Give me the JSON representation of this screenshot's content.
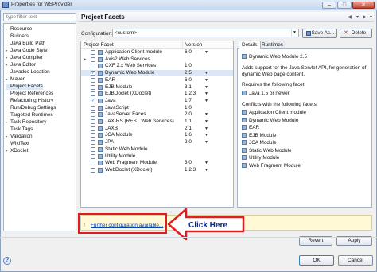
{
  "window": {
    "title": "Properties for WSProvider",
    "controls": [
      "–",
      "□",
      "✕"
    ]
  },
  "sidebar": {
    "filter_placeholder": "type filter text",
    "items": [
      {
        "label": "Resource",
        "expandable": true
      },
      {
        "label": "Builders",
        "expandable": false
      },
      {
        "label": "Java Build Path",
        "expandable": false
      },
      {
        "label": "Java Code Style",
        "expandable": true
      },
      {
        "label": "Java Compiler",
        "expandable": true
      },
      {
        "label": "Java Editor",
        "expandable": true
      },
      {
        "label": "Javadoc Location",
        "expandable": false
      },
      {
        "label": "Maven",
        "expandable": true
      },
      {
        "label": "Project Facets",
        "expandable": false,
        "selected": true
      },
      {
        "label": "Project References",
        "expandable": false
      },
      {
        "label": "Refactoring History",
        "expandable": false
      },
      {
        "label": "Run/Debug Settings",
        "expandable": false
      },
      {
        "label": "Targeted Runtimes",
        "expandable": false
      },
      {
        "label": "Task Repository",
        "expandable": true
      },
      {
        "label": "Task Tags",
        "expandable": false
      },
      {
        "label": "Validation",
        "expandable": true
      },
      {
        "label": "WikiText",
        "expandable": false
      },
      {
        "label": "XDoclet",
        "expandable": true
      }
    ]
  },
  "main": {
    "title": "Project Facets",
    "configuration_label": "Configuration:",
    "configuration_value": "<custom>",
    "save_as_label": "Save As...",
    "delete_label": "Delete",
    "table": {
      "col_facet": "Project Facet",
      "col_version": "Version",
      "rows": [
        {
          "name": "Application Client module",
          "version": "6.0",
          "checked": false,
          "dropdown": true
        },
        {
          "name": "Axis2 Web Services",
          "version": "",
          "checked": false,
          "expandable": true
        },
        {
          "name": "CXF 2.x Web Services",
          "version": "1.0",
          "checked": false
        },
        {
          "name": "Dynamic Web Module",
          "version": "2.5",
          "checked": true,
          "highlight": true,
          "dropdown": true
        },
        {
          "name": "EAR",
          "version": "6.0",
          "checked": false,
          "dropdown": true
        },
        {
          "name": "EJB Module",
          "version": "3.1",
          "checked": false,
          "dropdown": true
        },
        {
          "name": "EJBDoclet (XDoclet)",
          "version": "1.2.3",
          "checked": false,
          "dropdown": true
        },
        {
          "name": "Java",
          "version": "1.7",
          "checked": true,
          "dropdown": true
        },
        {
          "name": "JavaScript",
          "version": "1.0",
          "checked": false
        },
        {
          "name": "JavaServer Faces",
          "version": "2.0",
          "checked": false,
          "dropdown": true
        },
        {
          "name": "JAX-RS (REST Web Services)",
          "version": "1.1",
          "checked": false,
          "dropdown": true
        },
        {
          "name": "JAXB",
          "version": "2.1",
          "checked": false,
          "dropdown": true
        },
        {
          "name": "JCA Module",
          "version": "1.6",
          "checked": false,
          "dropdown": true
        },
        {
          "name": "JPA",
          "version": "2.0",
          "checked": false,
          "dropdown": true
        },
        {
          "name": "Static Web Module",
          "version": "",
          "checked": false
        },
        {
          "name": "Utility Module",
          "version": "",
          "checked": false
        },
        {
          "name": "Web Fragment Module",
          "version": "3.0",
          "checked": false,
          "dropdown": true
        },
        {
          "name": "WebDoclet (XDoclet)",
          "version": "1.2.3",
          "checked": false,
          "dropdown": true
        }
      ]
    },
    "details": {
      "tab_details": "Details",
      "tab_runtimes": "Runtimes",
      "facet_title": "Dynamic Web Module 2.5",
      "description_1": "Adds support for the Java Servlet API, for generation of",
      "description_2": "dynamic Web page content.",
      "requires_label": "Requires the following facet:",
      "requires_item": "Java 1.5 or newer",
      "conflicts_label": "Conflicts with the following facets:",
      "conflicts": [
        "Application Client module",
        "Dynamic Web Module",
        "EAR",
        "EJB Module",
        "JCA Module",
        "Static Web Module",
        "Utility Module",
        "Web Fragment Module"
      ]
    },
    "info_icon": "i",
    "further_config_link": "Further configuration available...",
    "revert_label": "Revert",
    "apply_label": "Apply"
  },
  "annotation": {
    "text": "Click Here",
    "color": "#e01e1e"
  },
  "footer": {
    "ok_label": "OK",
    "cancel_label": "Cancel"
  }
}
